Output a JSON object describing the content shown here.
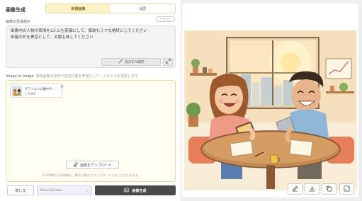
{
  "left": {
    "title": "画像生成",
    "tabs": [
      {
        "label": "新規画像",
        "active": true
      },
      {
        "label": "履歴",
        "active": false
      }
    ],
    "reset_label": "リセット",
    "prompt_label": "画像の生成指示",
    "prompt_lines": [
      "画像内の人物の表情を2人とも笑顔にして、服装もラフな格好にしてください",
      "部屋の外を青空にして、太陽も映してください"
    ],
    "ai_button_label": "指示をAI補完",
    "image_to_image": {
      "label": "Image to Image",
      "hint": "既存画像の全体や指定位置を参考にして、スタイルを変更します",
      "thumbnail_name": "ザファルメ公園中の...",
      "thumbnail_size": "1.99MB",
      "upload_label": "画像をアップロード",
      "upload_note": "※ 20MB以下の画像を、最大10個までアップロードすることができます。"
    },
    "footer": {
      "close_label": "閉じる",
      "model_value": "Nano Banana",
      "generate_label": "画像生成"
    }
  },
  "right": {
    "toolbar_icons": [
      "edit-icon",
      "download-icon",
      "copy-icon",
      "fullscreen-icon"
    ]
  }
}
